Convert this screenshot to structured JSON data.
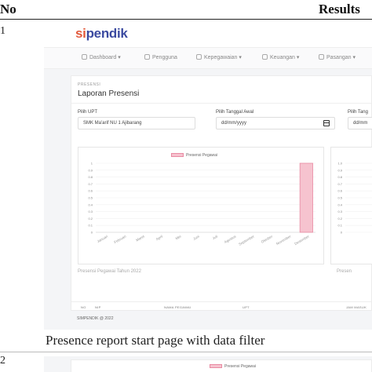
{
  "table": {
    "col_no": "No",
    "col_results": "Results",
    "rows": [
      {
        "no": "1",
        "caption": "Presence report start page with data filter"
      },
      {
        "no": "2"
      }
    ]
  },
  "app": {
    "logo_prefix": "si",
    "logo_main": "pendik",
    "menu": [
      "Dashboard",
      "Pengguna",
      "Kepegawaian",
      "Keuangan",
      "Pasangan"
    ],
    "breadcrumb": "PRESENSI",
    "page_title": "Laporan Presensi",
    "filter_upt": {
      "label": "Pilih UPT",
      "value": "SMK Ma'arif NU 1 Ajibarang"
    },
    "filter_start": {
      "label": "Pilih Tanggal Awal",
      "value": "dd/mm/yyyy"
    },
    "filter_end": {
      "label": "Pilih Tang",
      "value": "dd/mm"
    },
    "chart_caption": "Presensi Pegawai Tahun 2022",
    "chart_caption_2": "Presen",
    "table_headers": [
      "NO",
      "NIP",
      "NAMA PEGAWAI",
      "UPT",
      "JAM MASUK"
    ],
    "footer": "SIMPENDIK @ 2022"
  },
  "chart_data": {
    "type": "bar",
    "title": "",
    "legend": [
      "Presensi Pegawai"
    ],
    "categories": [
      "Januari",
      "Februari",
      "Maret",
      "April",
      "Mei",
      "Juni",
      "Juli",
      "Agustus",
      "September",
      "Oktober",
      "November",
      "Desember"
    ],
    "series": [
      {
        "name": "Presensi Pegawai",
        "values": [
          0,
          0,
          0,
          0,
          0,
          0,
          0,
          0,
          0,
          0,
          0,
          1
        ]
      }
    ],
    "yticks": [
      "1",
      "0.9",
      "0.8",
      "0.7",
      "0.6",
      "0.5",
      "0.4",
      "0.3",
      "0.2",
      "0.1",
      "0"
    ],
    "ylim": [
      0,
      1
    ],
    "colors": {
      "fill": "#f6c3cf",
      "stroke": "#e98aa2"
    }
  },
  "chart2": {
    "yticks": [
      "1.0",
      "0.9",
      "0.8",
      "0.7",
      "0.6",
      "0.5",
      "0.4",
      "0.3",
      "0.2",
      "0.1",
      "0"
    ]
  }
}
